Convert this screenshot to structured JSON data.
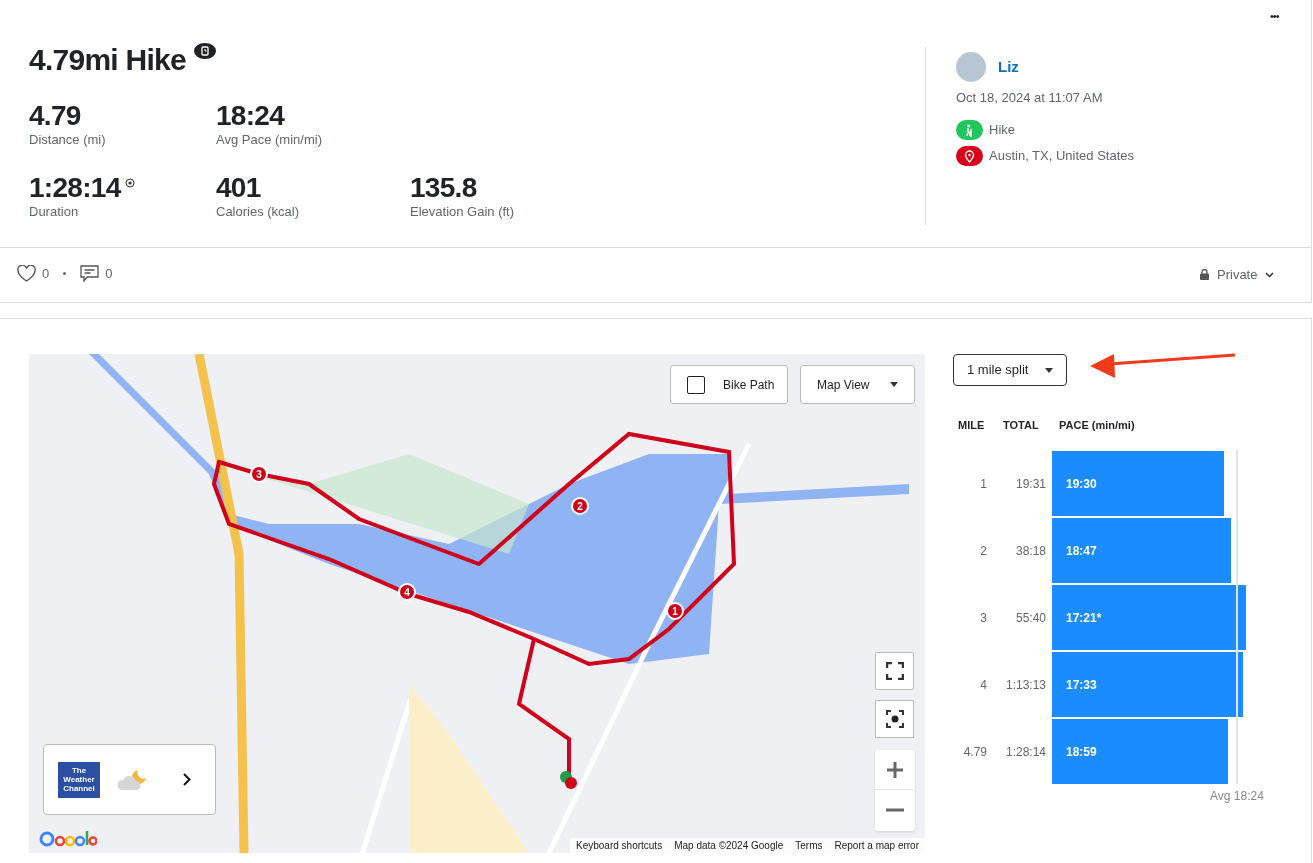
{
  "menu_button": "•••",
  "title": "4.79mi Hike",
  "stats": [
    {
      "value": "4.79",
      "label": "Distance (mi)"
    },
    {
      "value": "18:24",
      "label": "Avg Pace (min/mi)"
    },
    {
      "value": "1:28:14",
      "label": "Duration"
    },
    {
      "value": "401",
      "label": "Calories (kcal)"
    },
    {
      "value": "135.8",
      "label": "Elevation Gain (ft)"
    }
  ],
  "user": {
    "name": "Liz",
    "date": "Oct 18, 2024 at 11:07 AM",
    "activity": "Hike",
    "location": "Austin, TX, United States"
  },
  "social": {
    "likes": "0",
    "comments": "0"
  },
  "privacy": "Private",
  "map": {
    "bike_path": {
      "label": "Bike Path",
      "checked": false
    },
    "view": "Map View",
    "route_markers": [
      "1",
      "2",
      "3",
      "4"
    ],
    "attribution": [
      "Keyboard shortcuts",
      "Map data ©2024 Google",
      "Terms",
      "Report a map error"
    ],
    "weather_brand": "The Weather Channel"
  },
  "splits": {
    "selector": "1 mile split",
    "columns": [
      "MILE",
      "TOTAL",
      "PACE (min/mi)"
    ],
    "rows": [
      {
        "mile": "1",
        "total": "19:31",
        "pace": "19:30",
        "level": 0.86
      },
      {
        "mile": "2",
        "total": "38:18",
        "pace": "18:47",
        "level": 0.895
      },
      {
        "mile": "3",
        "total": "55:40",
        "pace": "17:21*",
        "level": 0.97
      },
      {
        "mile": "4",
        "total": "1:13:13",
        "pace": "17:33",
        "level": 0.955
      },
      {
        "mile": "4.79",
        "total": "1:28:14",
        "pace": "18:59",
        "level": 0.88
      }
    ],
    "average": "Avg 18:24"
  }
}
